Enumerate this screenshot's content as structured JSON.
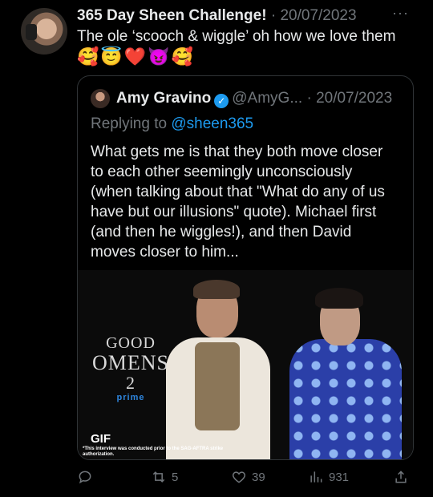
{
  "tweet": {
    "author_name": "365 Day Sheen Challenge!",
    "date": "20/07/2023",
    "text": "The ole ‘scooch & wiggle’ oh how we love them",
    "emojis": "🥰😇❤️😈🥰",
    "more_label": "···"
  },
  "quote": {
    "author_name": "Amy Gravino",
    "handle": "@AmyG...",
    "date": "20/07/2023",
    "replying_prefix": "Replying to",
    "replying_mention": "@sheen365",
    "lines": [
      "What gets me is that they both move closer",
      "to each other seemingly unconsciously",
      "(when talking about that \"What do any of us",
      "have but our illusions\" quote). Michael first",
      "(and then he wiggles!), and then David",
      "moves closer to him..."
    ],
    "media": {
      "logo_line1": "GOOD",
      "logo_line2": "OMENS",
      "logo_line3": "2",
      "logo_line4": "prime",
      "gif_badge": "GIF",
      "disclaimer": "*This interview was conducted prior to the SAG-AFTRA strike authorization."
    }
  },
  "actions": {
    "retweets": "5",
    "likes": "39",
    "views": "931"
  },
  "colors": {
    "background": "#000000",
    "text": "#e7e9ea",
    "muted": "#71767b",
    "link": "#1d9bf0",
    "border": "#2f3336"
  }
}
